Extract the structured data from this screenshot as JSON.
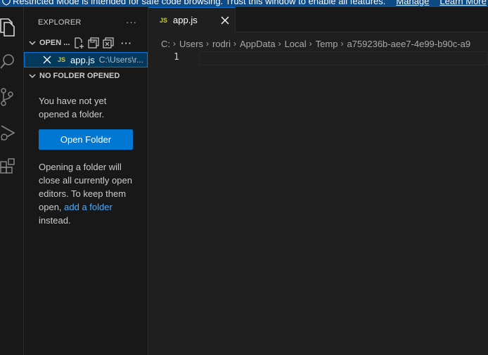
{
  "banner": {
    "text": "Restricted Mode is intended for safe code browsing. Trust this window to enable all features.",
    "manage_label": "Manage",
    "learn_more_label": "Learn More",
    "icon": "shield-icon"
  },
  "activity_bar": {
    "items": [
      {
        "name": "explorer",
        "icon": "files-icon"
      },
      {
        "name": "search",
        "icon": "search-icon"
      },
      {
        "name": "source-control",
        "icon": "source-control-icon"
      },
      {
        "name": "run-and-debug",
        "icon": "run-debug-icon"
      },
      {
        "name": "extensions",
        "icon": "extensions-icon"
      }
    ]
  },
  "sidebar": {
    "title": "EXPLORER",
    "more_label": "···",
    "open_editors": {
      "header": "OPEN ...",
      "files": [
        {
          "badge": "JS",
          "name": "app.js",
          "path": "C:\\Users\\r..."
        }
      ]
    },
    "no_folder": {
      "header": "NO FOLDER OPENED",
      "message": "You have not yet opened a folder.",
      "button_label": "Open Folder",
      "info_before": "Opening a folder will close all currently open editors. To keep them open, ",
      "link_label": "add a folder",
      "info_after": " instead."
    }
  },
  "editor": {
    "tab": {
      "badge": "JS",
      "name": "app.js"
    },
    "breadcrumb": [
      "C:",
      "Users",
      "rodri",
      "AppData",
      "Local",
      "Temp",
      "a759236b-aee7-4e99-b90c-a9"
    ],
    "line_numbers": [
      "1"
    ]
  },
  "colors": {
    "accent": "#0078d4",
    "banner_bg": "#0e4a86",
    "js_badge": "#cbcb41",
    "link": "#4daafc"
  }
}
